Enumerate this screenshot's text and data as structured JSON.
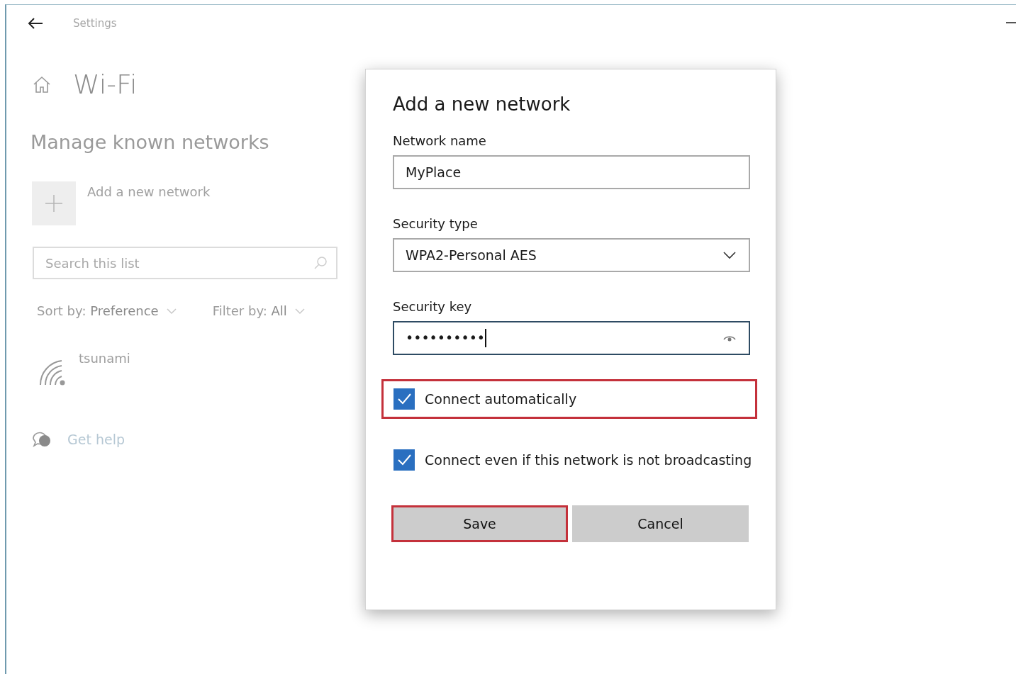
{
  "window": {
    "title": "Settings"
  },
  "page": {
    "title": "Wi-Fi"
  },
  "section": {
    "title": "Manage known networks",
    "add_button": "Add a new network",
    "search": {
      "placeholder": "Search this list"
    },
    "sort": "Sort by: **Preference**",
    "filter": "Filter by: **All**",
    "networks": [
      {
        "name": "tsunami"
      }
    ],
    "help_link": "Get help"
  },
  "dialog": {
    "title": "Add a new network",
    "fields": [
      {
        "kind": "text",
        "label": "Network name",
        "value": "MyPlace",
        "focused": false
      },
      {
        "kind": "dropdown",
        "label": "Security type",
        "value": "WPA2-Personal AES",
        "focused": false
      },
      {
        "kind": "password",
        "label": "Security key",
        "value": "••••••••••",
        "focused": true
      }
    ],
    "options": [
      {
        "label": "Connect automatically",
        "checked": true,
        "highlighted": true
      },
      {
        "label": "Connect even if this network is not broadcasting",
        "checked": true,
        "highlighted": false
      }
    ],
    "buttons": [
      {
        "label": "Save",
        "highlighted": true
      },
      {
        "label": "Cancel",
        "highlighted": false
      }
    ]
  }
}
